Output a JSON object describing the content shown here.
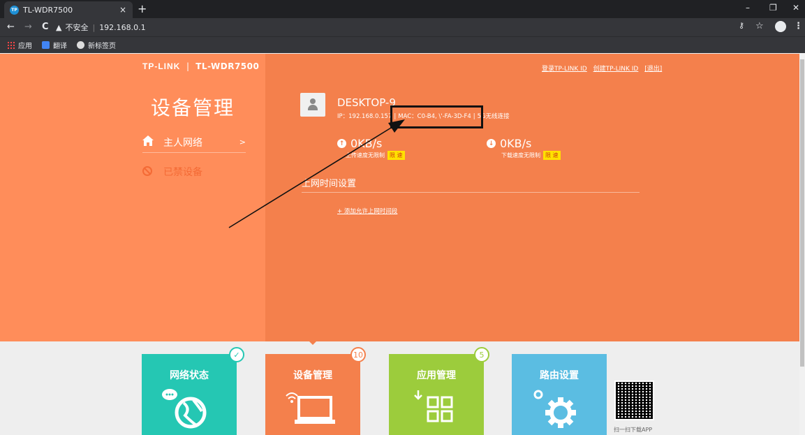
{
  "browser": {
    "tab_title": "TL-WDR7500",
    "tab_favicon": "TP",
    "tab_close": "×",
    "new_tab": "+",
    "window_controls": [
      "–",
      "❐",
      "✕"
    ],
    "nav": {
      "back": "←",
      "forward": "→",
      "reload": "C"
    },
    "security_label": "不安全",
    "url": "192.168.0.1",
    "bookmarks": [
      {
        "label": "应用",
        "icon": "apps-grid-icon"
      },
      {
        "label": "翻译",
        "icon": "translate-icon"
      },
      {
        "label": "新标签页",
        "icon": "globe-icon"
      }
    ]
  },
  "header": {
    "brand": "TP-LINK",
    "divider": "|",
    "model": "TL-WDR7500",
    "links": [
      "登录TP-LINK ID",
      "创建TP-LINK ID",
      "[退出]"
    ]
  },
  "sidebar": {
    "title": "设备管理",
    "items": [
      {
        "label": "主人网络",
        "arrow": ">"
      },
      {
        "label": "已禁设备"
      }
    ]
  },
  "device": {
    "name": "DESKTOP-9",
    "ip": "IP：192.168.0.157",
    "mac": "MAC：C0-B4,  \\'-FA-3D-F4",
    "connection": "5G无线连接",
    "sep": "|"
  },
  "speed": {
    "upload_value": "0KB/s",
    "upload_label": "上传速度无限制",
    "download_value": "0KB/s",
    "download_label": "下载速度无限制",
    "limit_button": "限 速"
  },
  "schedule": {
    "title": "上网时间设置",
    "add_link": "+ 添加允许上网时间段"
  },
  "tiles": [
    {
      "label": "网络状态",
      "badge": "✓",
      "color": "#25c7b3",
      "badge_color": "#25c7b3",
      "icon": "globe-chat-icon"
    },
    {
      "label": "设备管理",
      "badge": "10",
      "color": "#f4804c",
      "badge_color": "#f4804c",
      "icon": "laptop-wifi-icon"
    },
    {
      "label": "应用管理",
      "badge": "5",
      "color": "#9ccc3c",
      "badge_color": "#9ccc3c",
      "icon": "apps-download-icon"
    },
    {
      "label": "路由设置",
      "badge": "",
      "color": "#5bbde2",
      "icon": "gear-icon"
    }
  ],
  "qr_label": "扫一扫下载APP",
  "colors": {
    "left_panel": "#ff8d5a",
    "main_panel": "#f4804c",
    "limit_button_bg": "#ffe100"
  }
}
